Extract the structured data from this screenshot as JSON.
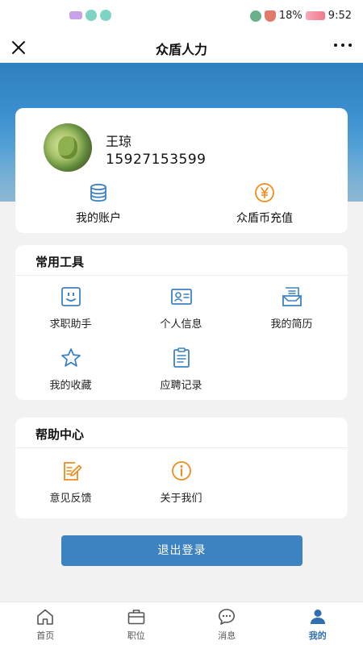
{
  "status_bar": {
    "battery": "18%",
    "time": "9:52"
  },
  "nav": {
    "title": "众盾人力"
  },
  "profile": {
    "name": "王琼",
    "phone": "15927153599",
    "account_label": "我的账户",
    "recharge_label": "众盾币充值"
  },
  "tools": {
    "title": "常用工具",
    "items": [
      {
        "label": "求职助手",
        "icon": "smile-icon"
      },
      {
        "label": "个人信息",
        "icon": "id-card-icon"
      },
      {
        "label": "我的简历",
        "icon": "resume-icon"
      },
      {
        "label": "我的收藏",
        "icon": "star-icon"
      },
      {
        "label": "应聘记录",
        "icon": "clipboard-icon"
      }
    ]
  },
  "help": {
    "title": "帮助中心",
    "items": [
      {
        "label": "意见反馈",
        "icon": "feedback-icon"
      },
      {
        "label": "关于我们",
        "icon": "info-icon"
      }
    ]
  },
  "logout_label": "退出登录",
  "tabs": [
    {
      "label": "首页",
      "icon": "home-icon"
    },
    {
      "label": "职位",
      "icon": "briefcase-icon"
    },
    {
      "label": "消息",
      "icon": "chat-icon"
    },
    {
      "label": "我的",
      "icon": "user-icon",
      "active": true
    }
  ],
  "colors": {
    "primary": "#3d82c1",
    "accent_orange": "#f08a1c",
    "active_tab": "#2f6fb0"
  }
}
